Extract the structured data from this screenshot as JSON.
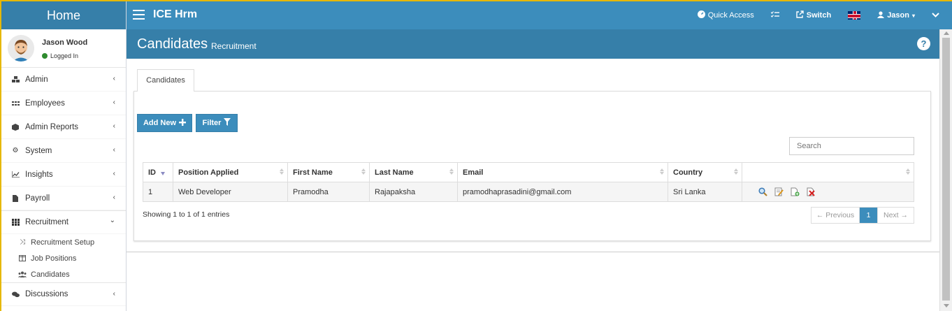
{
  "brand": "Home",
  "user": {
    "name": "Jason Wood",
    "status": "Logged In"
  },
  "sidebar": {
    "items": [
      {
        "label": "Admin",
        "icon": "cubes-icon"
      },
      {
        "label": "Employees",
        "icon": "grid-dots-icon"
      },
      {
        "label": "Admin Reports",
        "icon": "cube-icon"
      },
      {
        "label": "System",
        "icon": "cogs-icon"
      },
      {
        "label": "Insights",
        "icon": "line-chart-icon"
      },
      {
        "label": "Payroll",
        "icon": "file-icon"
      },
      {
        "label": "Recruitment",
        "icon": "th-icon"
      },
      {
        "label": "Discussions",
        "icon": "comments-icon"
      }
    ],
    "recruitment_sub": [
      {
        "label": "Recruitment Setup",
        "icon": "random-icon"
      },
      {
        "label": "Job Positions",
        "icon": "columns-icon"
      },
      {
        "label": "Candidates",
        "icon": "users-icon"
      }
    ]
  },
  "navbar": {
    "title": "ICE Hrm",
    "quick_access": "Quick Access",
    "switch": "Switch",
    "user": "Jason"
  },
  "header": {
    "title": "Candidates",
    "subtitle": "Recruitment"
  },
  "tabs": {
    "active": "Candidates"
  },
  "toolbar": {
    "add_label": "Add New",
    "filter_label": "Filter"
  },
  "search": {
    "placeholder": "Search"
  },
  "table": {
    "columns": [
      "ID",
      "Position Applied",
      "First Name",
      "Last Name",
      "Email",
      "Country",
      ""
    ],
    "rows": [
      {
        "id": "1",
        "position": "Web Developer",
        "first": "Pramodha",
        "last": "Rajapaksha",
        "email": "pramodhaprasadini@gmail.com",
        "country": "Sri Lanka"
      }
    ]
  },
  "pagination": {
    "info": "Showing 1 to 1 of 1 entries",
    "prev": "← Previous",
    "current": "1",
    "next": "Next →"
  },
  "colors": {
    "primary": "#3c8dbc",
    "primary_dark": "#367fa9"
  }
}
